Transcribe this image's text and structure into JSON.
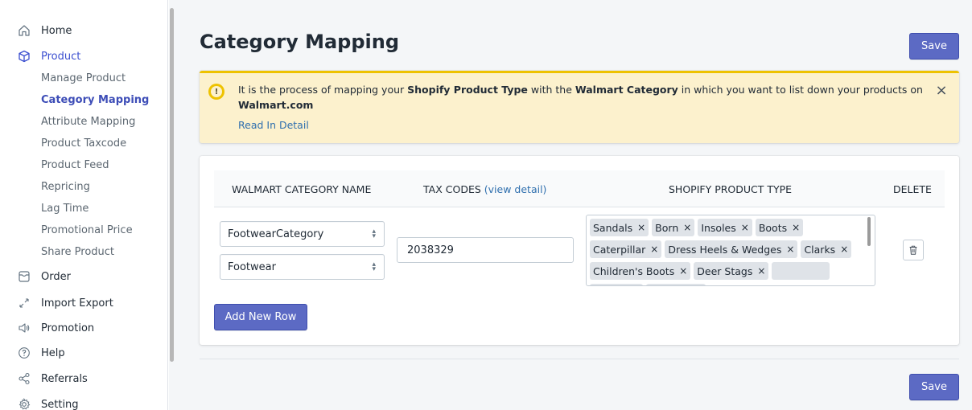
{
  "sidebar": {
    "items": [
      {
        "label": "Home",
        "icon": "home-icon"
      },
      {
        "label": "Product",
        "icon": "cube-icon"
      },
      {
        "label": "Order",
        "icon": "inbox-icon"
      },
      {
        "label": "Import Export",
        "icon": "arrows-diagonal-icon"
      },
      {
        "label": "Promotion",
        "icon": "speaker-icon"
      },
      {
        "label": "Help",
        "icon": "question-icon"
      },
      {
        "label": "Referrals",
        "icon": "share-icon"
      },
      {
        "label": "Setting",
        "icon": "gear-icon"
      }
    ],
    "product_sub": [
      "Manage Product",
      "Category Mapping",
      "Attribute Mapping",
      "Product Taxcode",
      "Product Feed",
      "Repricing",
      "Lag Time",
      "Promotional Price",
      "Share Product"
    ]
  },
  "page": {
    "title": "Category Mapping",
    "save_label": "Save"
  },
  "banner": {
    "text_1": "It is the process of mapping your ",
    "bold_1": "Shopify Product Type",
    "text_2": " with the ",
    "bold_2": "Walmart Category",
    "text_3": " in which you want to list down your products on ",
    "bold_3": "Walmart.com",
    "link": "Read In Detail",
    "close": "×",
    "icon_glyph": "!"
  },
  "table": {
    "headers": {
      "category": "WALMART CATEGORY NAME",
      "tax": "TAX CODES",
      "tax_link": "(view detail)",
      "shopify": "SHOPIFY PRODUCT TYPE",
      "delete": "DELETE"
    },
    "row": {
      "category_select": "FootwearCategory",
      "subcategory_select": "Footwear",
      "tax_code": "2038329",
      "tags": [
        "Sandals",
        "Born",
        "Insoles",
        "Boots",
        "Caterpillar",
        "Dress Heels & Wedges",
        "Clarks",
        "Children's Boots",
        "Deer Stags"
      ]
    },
    "add_row_label": "Add New Row"
  },
  "colors": {
    "primary": "#5c6ac4",
    "banner_bg": "#fcf1cd",
    "banner_border": "#eec200",
    "link": "#2f6fae"
  }
}
